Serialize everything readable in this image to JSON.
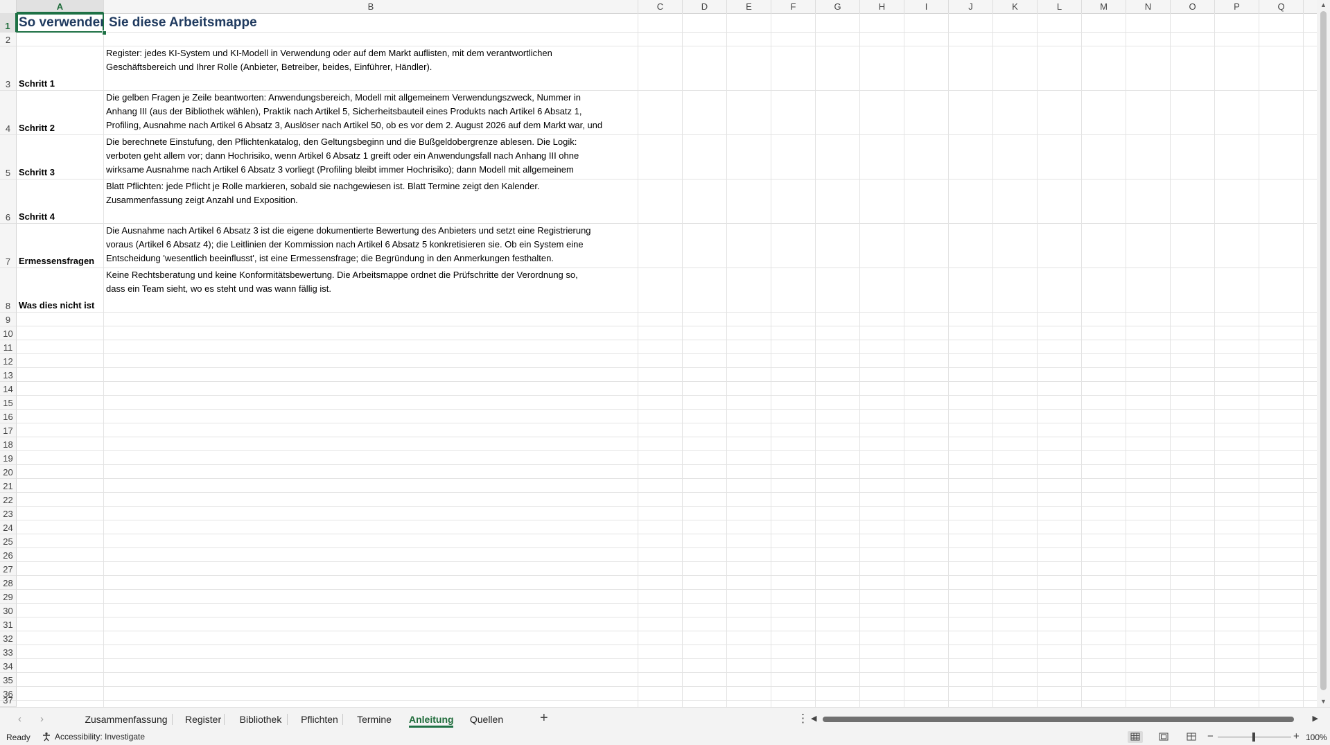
{
  "columns": [
    "A",
    "B",
    "C",
    "D",
    "E",
    "F",
    "G",
    "H",
    "I",
    "J",
    "K",
    "L",
    "M",
    "N",
    "O",
    "P",
    "Q"
  ],
  "selected_column": "A",
  "selected_row": "1",
  "row_numbers": [
    "1",
    "2",
    "3",
    "4",
    "5",
    "6",
    "7",
    "8",
    "9",
    "10",
    "11",
    "12",
    "13",
    "14",
    "15",
    "16",
    "17",
    "18",
    "19",
    "20",
    "21",
    "22",
    "23",
    "24",
    "25",
    "26",
    "27",
    "28",
    "29",
    "30",
    "31",
    "32",
    "33",
    "34",
    "35",
    "36",
    "37"
  ],
  "title": {
    "a_part": "So verwenden",
    "b_part": "Sie diese Arbeitsmappe"
  },
  "rows": [
    {
      "row": "3",
      "label": "Schritt 1",
      "lines": [
        "Register: jedes KI-System und KI-Modell in Verwendung oder auf dem Markt auflisten, mit dem verantwortlichen",
        "Geschäftsbereich und Ihrer Rolle (Anbieter, Betreiber, beides, Einführer, Händler)."
      ]
    },
    {
      "row": "4",
      "label": "Schritt 2",
      "lines": [
        "Die gelben Fragen je Zeile beantworten: Anwendungsbereich, Modell mit allgemeinem Verwendungszweck, Nummer in",
        "Anhang III (aus der Bibliothek wählen), Praktik nach Artikel 5, Sicherheitsbauteil eines Produkts nach Artikel 6 Absatz 1,",
        "Profiling, Ausnahme nach Artikel 6 Absatz 3, Auslöser nach Artikel 50, ob es vor dem 2. August 2026 auf dem Markt war, und"
      ]
    },
    {
      "row": "5",
      "label": "Schritt 3",
      "lines": [
        "Die berechnete Einstufung, den Pflichtenkatalog, den Geltungsbeginn und die Bußgeldobergrenze ablesen. Die Logik:",
        "verboten geht allem vor; dann Hochrisiko, wenn Artikel 6 Absatz 1 greift oder ein Anwendungsfall nach Anhang III ohne",
        "wirksame Ausnahme nach Artikel 6 Absatz 3 vorliegt (Profiling bleibt immer Hochrisiko); dann Modell mit allgemeinem"
      ]
    },
    {
      "row": "6",
      "label": "Schritt 4",
      "lines": [
        "Blatt Pflichten: jede Pflicht je Rolle markieren, sobald sie nachgewiesen ist. Blatt Termine zeigt den Kalender.",
        "Zusammenfassung zeigt Anzahl und Exposition."
      ]
    },
    {
      "row": "7",
      "label": "Ermessensfragen",
      "lines": [
        "Die Ausnahme nach Artikel 6 Absatz 3 ist die eigene dokumentierte Bewertung des Anbieters und setzt eine Registrierung",
        "voraus (Artikel 6 Absatz 4); die Leitlinien der Kommission nach Artikel 6 Absatz 5 konkretisieren sie. Ob ein System eine",
        "Entscheidung 'wesentlich beeinflusst', ist eine Ermessensfrage; die Begründung in den Anmerkungen festhalten."
      ]
    },
    {
      "row": "8",
      "label": "Was dies nicht ist",
      "lines": [
        "Keine Rechtsberatung und keine Konformitätsbewertung. Die Arbeitsmappe ordnet die Prüfschritte der Verordnung so,",
        "dass ein Team sieht, wo es steht und was wann fällig ist."
      ]
    }
  ],
  "tabs": [
    {
      "label": "Zusammenfassung",
      "active": false
    },
    {
      "label": "Register",
      "active": false
    },
    {
      "label": "Bibliothek",
      "active": false
    },
    {
      "label": "Pflichten",
      "active": false
    },
    {
      "label": "Termine",
      "active": false
    },
    {
      "label": "Anleitung",
      "active": true
    },
    {
      "label": "Quellen",
      "active": false
    }
  ],
  "status": {
    "ready": "Ready",
    "accessibility": "Accessibility: Investigate",
    "zoom": "100%"
  },
  "colors": {
    "accent": "#1e7145",
    "title": "#1f3a5f"
  }
}
